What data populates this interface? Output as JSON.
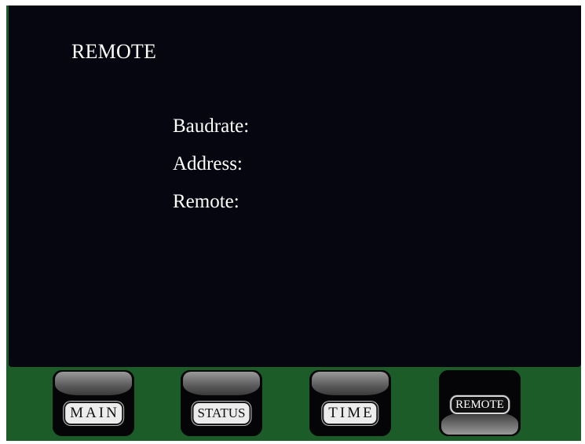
{
  "screen": {
    "title": "REMOTE",
    "fields": {
      "baudrate_label": "Baudrate:",
      "address_label": "Address:",
      "remote_label": "Remote:"
    }
  },
  "nav": {
    "main": "MAIN",
    "status": "STATUS",
    "time": "TIME",
    "remote": "REMOTE",
    "active": "REMOTE"
  },
  "colors": {
    "background": "#05060f",
    "frame": "#1c5c28",
    "text": "#ffffff"
  }
}
